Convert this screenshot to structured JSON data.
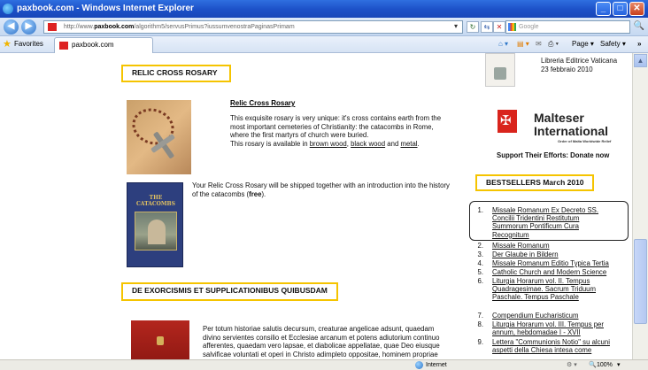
{
  "window": {
    "title": "paxbook.com - Windows Internet Explorer",
    "minimize": "_",
    "maximize": "□",
    "close": "✕"
  },
  "nav": {
    "back": "◀",
    "forward": "▶",
    "address_prefix": "http://www.",
    "address_host": "paxbook.com",
    "address_path": "/algorithm5/servusPrimus?iussumvenostraPaginasPrimam",
    "dropdown": "▾",
    "refresh": "↻",
    "compat": "⇆",
    "stop": "✕",
    "search_placeholder": "Google",
    "search_go": "🔍"
  },
  "favorites_bar": {
    "favorites_label": "Favorites",
    "tab_label": "paxbook.com",
    "cmd_home": "⌂ ▾",
    "cmd_feeds": "▤ ▾",
    "cmd_mail": "✉",
    "cmd_print": "⎙ ▾",
    "page_label": "Page ▾",
    "safety_label": "Safety ▾",
    "more": "»"
  },
  "main": {
    "section1_title": "RELIC CROSS ROSARY",
    "product1": {
      "title": "Relic Cross Rosary",
      "desc_line1": "This exquisite rosary is very unique: it's cross contains earth from the",
      "desc_line2": "most important cemeteries of Christianity: the catacombs in Rome,",
      "desc_line3": "where the first martyrs of church were buried.",
      "desc_line4_prefix": "This rosary is available in ",
      "link_brown": "brown wood",
      "sep1": ", ",
      "link_black": "black wood",
      "sep2": " and ",
      "link_metal": "metal",
      "end": "."
    },
    "product2": {
      "book_title": "THE CATACOMBS",
      "line1": "Your Relic Cross Rosary will be shipped together with an introduction into the history",
      "line2_prefix": "of the catacombs (",
      "line2_bold": "free",
      "line2_suffix": ")."
    },
    "section2_title": "DE EXORCISMIS ET SUPPLICATIONIBUS QUIBUSDAM",
    "product3": {
      "line1": "Per totum historiae salutis decursum, creaturae angelicae adsunt, quaedam",
      "line2": "divino servientes consilio et Ecclesiae arcanum et potens adiutorium continuo",
      "line3": "afferentes, quaedam vero lapsae, et diabolicae appellatae, quae Deo eiusque",
      "line4": "salvificae voluntati et operi in Christo adimpleto oppositae, hominem propriae"
    }
  },
  "sidebar": {
    "vatican_line1": "Libreria Editrice Vaticana",
    "vatican_line2": "23 febbraio 2010",
    "malteser_line1": "Malteser",
    "malteser_line2": "International",
    "malteser_sub": "Order of Malta Worldwide Relief",
    "support": "Support Their Efforts: Donate now",
    "bestsellers_title": "BESTSELLERS March 2010",
    "bestsellers": [
      {
        "num": "1.",
        "lines": [
          "Missale Romanum Ex Decreto SS.",
          "Concilii Tridentini Restitutum",
          "Summorum Pontificum Cura",
          "Recognitum"
        ]
      },
      {
        "num": "2.",
        "lines": [
          "Missale Romanum"
        ]
      },
      {
        "num": "3.",
        "lines": [
          "Der Glaube in Bildern"
        ]
      },
      {
        "num": "4.",
        "lines": [
          "Missale Romanum Editio Typica Tertia"
        ]
      },
      {
        "num": "5.",
        "lines": [
          "Catholic Church and Modern Science"
        ]
      },
      {
        "num": "6.",
        "lines": [
          "Liturgia Horarum vol. II. Tempus",
          "Quadragesimae. Sacrum Triduum",
          "Paschale. Tempus Paschale"
        ]
      },
      {
        "num": "7.",
        "lines": [
          "Compendium Eucharisticum"
        ]
      },
      {
        "num": "8.",
        "lines": [
          "Liturgia Horarum vol. III. Tempus per",
          "annum, hebdomadae I - XVII"
        ]
      },
      {
        "num": "9.",
        "lines": [
          "Lettera \"Communionis Notio\" su alcuni",
          "aspetti della Chiesa intesa come"
        ]
      }
    ]
  },
  "status": {
    "zone": "Internet",
    "security": "⚙ ▾",
    "zoom_icon": "🔍",
    "zoom": "100%",
    "zoom_caret": "▾"
  }
}
